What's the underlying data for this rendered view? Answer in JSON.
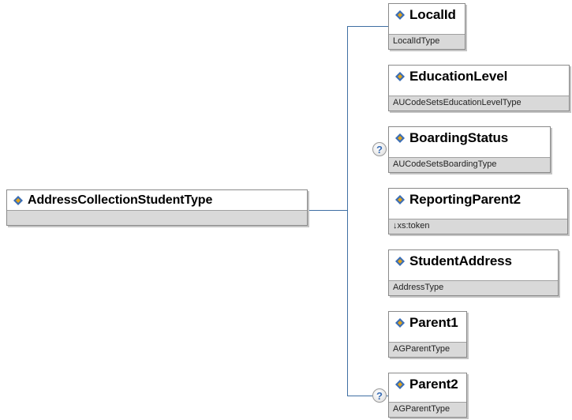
{
  "root": {
    "name": "AddressCollectionStudentType",
    "type": ""
  },
  "children": [
    {
      "name": "LocalId",
      "type": "LocalIdType",
      "optional": false
    },
    {
      "name": "EducationLevel",
      "type": "AUCodeSetsEducationLevelType",
      "optional": false
    },
    {
      "name": "BoardingStatus",
      "type": "AUCodeSetsBoardingType",
      "optional": true
    },
    {
      "name": "ReportingParent2",
      "type": "↓xs:token",
      "optional": false
    },
    {
      "name": "StudentAddress",
      "type": "AddressType",
      "optional": false
    },
    {
      "name": "Parent1",
      "type": "AGParentType",
      "optional": false
    },
    {
      "name": "Parent2",
      "type": "AGParentType",
      "optional": true
    }
  ],
  "optional_marker": "?",
  "colors": {
    "connector": "#3f6fa3",
    "footer": "#d9d9d9",
    "icon_blue": "#3a6db5",
    "icon_gold": "#e2a41b"
  }
}
